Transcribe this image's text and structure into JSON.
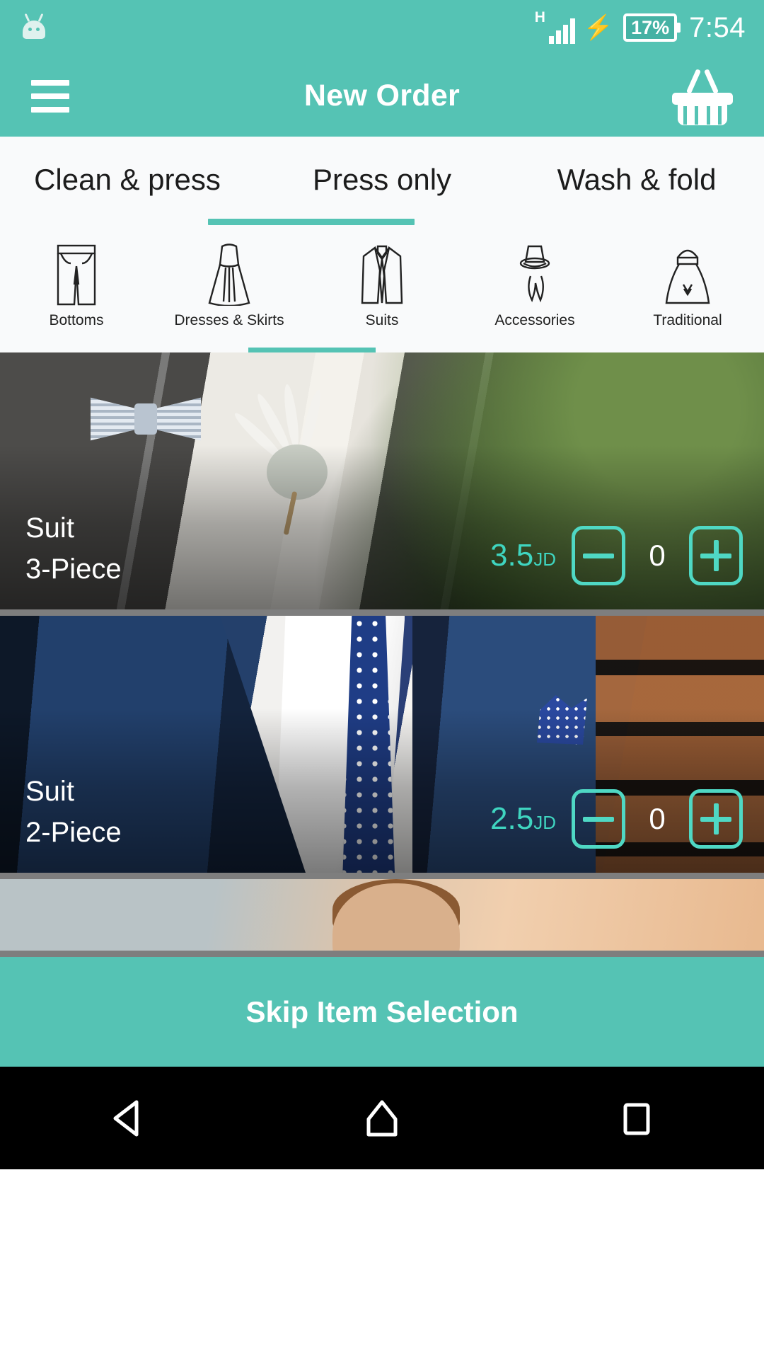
{
  "status_bar": {
    "robot_icon": "android-robot-icon",
    "network_type": "H",
    "signal_icon": "signal-bars-icon",
    "charging_icon": "charging-bolt-icon",
    "battery_percent": "17%",
    "time": "7:54"
  },
  "app_bar": {
    "menu_icon": "hamburger-menu-icon",
    "title": "New Order",
    "cart_icon": "shopping-basket-icon"
  },
  "service_tabs": {
    "items": [
      {
        "label": "Clean & press",
        "selected": false
      },
      {
        "label": "Press only",
        "selected": true
      },
      {
        "label": "Wash & fold",
        "selected": false
      }
    ]
  },
  "categories": {
    "items": [
      {
        "label": "Bottoms",
        "icon": "trousers-icon",
        "selected": false
      },
      {
        "label": "Dresses & Skirts",
        "icon": "dress-icon",
        "selected": false
      },
      {
        "label": "Suits",
        "icon": "suit-jacket-icon",
        "selected": true
      },
      {
        "label": "Accessories",
        "icon": "hat-scarf-icon",
        "selected": false
      },
      {
        "label": "Traditional",
        "icon": "thobe-icon",
        "selected": false
      }
    ]
  },
  "products": [
    {
      "title": "Suit",
      "subtitle": "3-Piece",
      "price": "3.5",
      "currency": "JD",
      "quantity": "0",
      "minus_icon": "minus-icon",
      "plus_icon": "plus-icon"
    },
    {
      "title": "Suit",
      "subtitle": "2-Piece",
      "price": "2.5",
      "currency": "JD",
      "quantity": "0",
      "minus_icon": "minus-icon",
      "plus_icon": "plus-icon"
    }
  ],
  "skip_button": {
    "label": "Skip Item Selection"
  },
  "nav_bar": {
    "back_icon": "back-triangle-icon",
    "home_icon": "home-icon",
    "recents_icon": "recents-square-icon"
  },
  "colors": {
    "brand_teal": "#55C3B4",
    "accent_teal": "#4FD8C4",
    "tab_bg": "#F9FAFB",
    "nav_bg": "#000000"
  }
}
